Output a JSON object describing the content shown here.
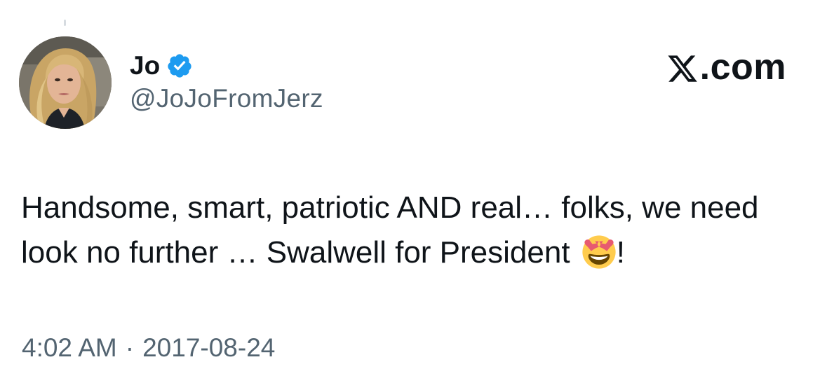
{
  "author": {
    "display_name": "Jo",
    "handle": "@JoJoFromJerz",
    "verified": true,
    "avatar_icon": "profile-photo-woman-blonde"
  },
  "brand": {
    "label": ".com",
    "logo_icon": "x-logo-icon"
  },
  "tweet": {
    "text_before_emoji": "Handsome, smart, patriotic AND real… folks, we need look no further … Swalwell for President ",
    "emoji_icon": "heart-eyes-emoji",
    "text_after_emoji": "!"
  },
  "meta": {
    "time": "4:02 AM",
    "separator": "·",
    "date": "2017-08-24"
  },
  "colors": {
    "primary_text": "#0f1419",
    "secondary_text": "#536471",
    "verified_blue": "#1d9bf0",
    "background": "#ffffff"
  }
}
